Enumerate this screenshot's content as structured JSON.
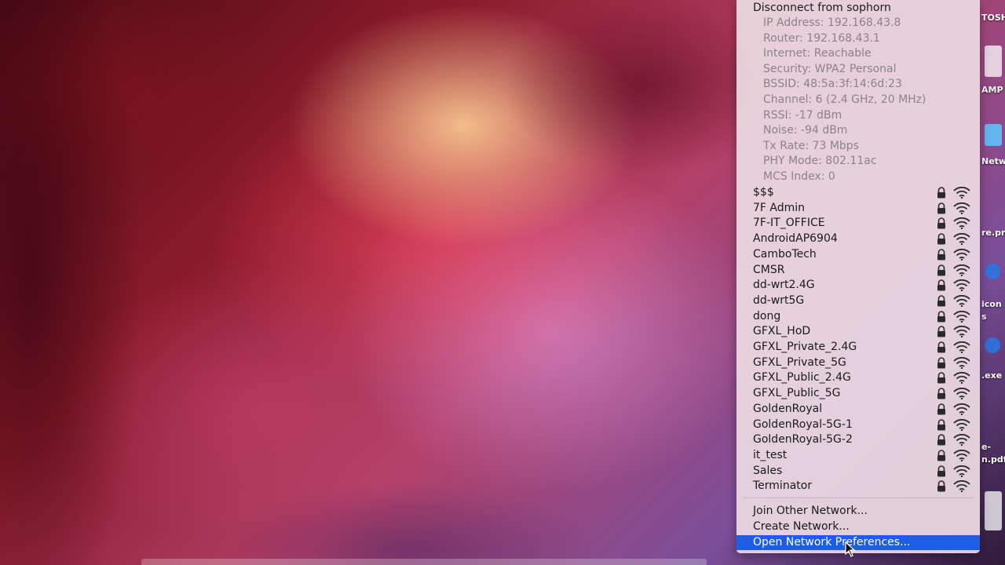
{
  "wifi_menu": {
    "disconnect_label": "Disconnect from sophorn",
    "details": [
      "IP Address: 192.168.43.8",
      "Router: 192.168.43.1",
      "Internet: Reachable",
      "Security: WPA2 Personal",
      "BSSID: 48:5a:3f:14:6d:23",
      "Channel: 6 (2.4 GHz, 20 MHz)",
      "RSSI: -17 dBm",
      "Noise: -94 dBm",
      "Tx Rate: 73 Mbps",
      "PHY Mode: 802.11ac",
      "MCS Index: 0"
    ],
    "networks": [
      {
        "name": "$$$",
        "secured": true,
        "signal_icon": "wifi-signal-icon"
      },
      {
        "name": "7F Admin",
        "secured": true,
        "signal_icon": "wifi-signal-icon"
      },
      {
        "name": "7F-IT_OFFICE",
        "secured": true,
        "signal_icon": "wifi-signal-icon"
      },
      {
        "name": "AndroidAP6904",
        "secured": true,
        "signal_icon": "wifi-signal-icon"
      },
      {
        "name": "CamboTech",
        "secured": true,
        "signal_icon": "wifi-signal-icon"
      },
      {
        "name": "CMSR",
        "secured": true,
        "signal_icon": "wifi-signal-icon"
      },
      {
        "name": "dd-wrt2.4G",
        "secured": true,
        "signal_icon": "wifi-signal-icon"
      },
      {
        "name": "dd-wrt5G",
        "secured": true,
        "signal_icon": "wifi-signal-icon"
      },
      {
        "name": "dong",
        "secured": true,
        "signal_icon": "wifi-signal-icon"
      },
      {
        "name": "GFXL_HoD",
        "secured": true,
        "signal_icon": "wifi-signal-icon"
      },
      {
        "name": "GFXL_Private_2.4G",
        "secured": true,
        "signal_icon": "wifi-signal-icon"
      },
      {
        "name": "GFXL_Private_5G",
        "secured": true,
        "signal_icon": "wifi-signal-icon"
      },
      {
        "name": "GFXL_Public_2.4G",
        "secured": true,
        "signal_icon": "wifi-signal-icon"
      },
      {
        "name": "GFXL_Public_5G",
        "secured": true,
        "signal_icon": "wifi-signal-icon"
      },
      {
        "name": "GoldenRoyal",
        "secured": true,
        "signal_icon": "wifi-signal-icon"
      },
      {
        "name": "GoldenRoyal-5G-1",
        "secured": true,
        "signal_icon": "wifi-signal-icon"
      },
      {
        "name": "GoldenRoyal-5G-2",
        "secured": true,
        "signal_icon": "wifi-signal-icon"
      },
      {
        "name": "it_test",
        "secured": true,
        "signal_icon": "wifi-signal-icon"
      },
      {
        "name": "Sales",
        "secured": true,
        "signal_icon": "wifi-signal-icon"
      },
      {
        "name": "Terminator",
        "secured": true,
        "signal_icon": "wifi-signal-icon"
      }
    ],
    "actions": {
      "join_other": "Join Other Network...",
      "create": "Create Network...",
      "open_prefs": "Open Network Preferences..."
    },
    "highlight_color": "#1e5ee6"
  },
  "desktop_icons": {
    "labels": [
      "TOSH",
      "AMP",
      "Netw",
      "re.pn",
      "icon",
      "s",
      ".exe",
      "e-",
      "n.pdf"
    ]
  }
}
